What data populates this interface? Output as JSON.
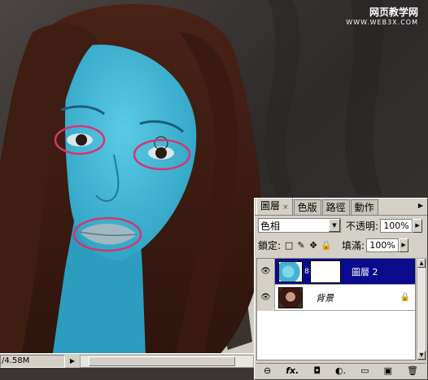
{
  "watermark": {
    "line1": "网页教学网",
    "line2": "WWW.WEB3X.COM"
  },
  "status": {
    "doc_size": "/4.58M",
    "arrow": "▶"
  },
  "layers_panel": {
    "tabs": [
      {
        "label": "圖層",
        "active": true,
        "close": "×"
      },
      {
        "label": "色版",
        "active": false
      },
      {
        "label": "路徑",
        "active": false
      },
      {
        "label": "動作",
        "active": false
      }
    ],
    "menu_icon": "▶",
    "blend_mode": "色相",
    "opacity_label": "不透明:",
    "opacity_value": "100%",
    "lock_label": "鎖定:",
    "fill_label": "填滿:",
    "fill_value": "100%",
    "lock_icons": [
      "□",
      "✎",
      "✥",
      "🔒"
    ],
    "layers": [
      {
        "name": "圖層 2",
        "selected": true,
        "visible": true
      },
      {
        "name": "背景",
        "selected": false,
        "visible": true,
        "locked": true
      }
    ],
    "toolbar_icons": [
      "⊖",
      "fx.",
      "◘",
      "◐.",
      "▭",
      "▣",
      "🗑"
    ]
  },
  "colors": {
    "skin": "#3bb7d6",
    "highlight_ellipse": "#d5356e",
    "panel_bg": "#d4d0c8",
    "selected_layer": "#0a0a8c"
  }
}
